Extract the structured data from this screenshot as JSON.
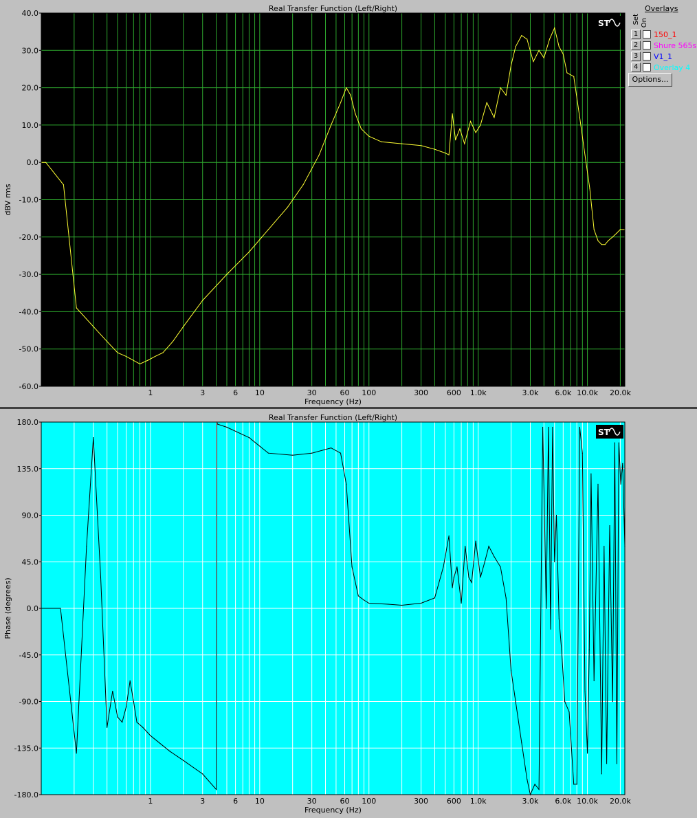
{
  "overlays": {
    "title": "Overlays",
    "header_set": "Set",
    "header_on": "On",
    "items": [
      {
        "num": "1",
        "label": "150_1",
        "color": "#ff0000"
      },
      {
        "num": "2",
        "label": "Shure 565s",
        "color": "#ff00ff"
      },
      {
        "num": "3",
        "label": "V1_1",
        "color": "#0000ff"
      },
      {
        "num": "4",
        "label": "Overlay 4",
        "color": "#00ffff"
      }
    ],
    "options_label": "Options..."
  },
  "logo_text": "ST",
  "chart_data": [
    {
      "type": "line",
      "title": "Real Transfer Function (Left/Right)",
      "xlabel": "Frequency (Hz)",
      "ylabel": "dBV rms",
      "xscale": "log",
      "xlim": [
        0.1,
        22000
      ],
      "ylim": [
        -60,
        40
      ],
      "grid": true,
      "background": "#000000",
      "grid_color": "#2ea82e",
      "line_color": "#ffff33",
      "x_ticks": [
        1,
        3,
        6,
        10,
        30,
        60,
        100,
        300,
        600,
        1000,
        3000,
        6000,
        10000,
        20000
      ],
      "x_tick_labels": [
        "1",
        "3",
        "6",
        "10",
        "30",
        "60",
        "100",
        "300",
        "600",
        "1.0k",
        "3.0k",
        "6.0k",
        "10.0k",
        "20.0k"
      ],
      "y_ticks": [
        40,
        30,
        20,
        10,
        0,
        -10,
        -20,
        -30,
        -40,
        -50,
        -60
      ],
      "y_tick_labels": [
        "40.0",
        "30.0",
        "20.0",
        "10.0",
        "0.0",
        "-10.0",
        "-20.0",
        "-30.0",
        "-40.0",
        "-50.0",
        "-60.0"
      ],
      "series": [
        {
          "x": [
            0.1,
            0.11,
            0.16,
            0.21,
            0.3,
            0.4,
            0.5,
            0.6,
            0.8,
            0.95,
            1.1,
            1.3,
            1.6,
            2,
            3,
            5,
            8,
            12,
            18,
            25,
            35,
            45,
            55,
            62,
            68,
            75,
            85,
            100,
            130,
            200,
            300,
            400,
            500,
            540,
            580,
            620,
            680,
            750,
            850,
            950,
            1050,
            1200,
            1400,
            1600,
            1800,
            2000,
            2200,
            2500,
            2800,
            3200,
            3600,
            4000,
            4500,
            5000,
            5500,
            6000,
            6500,
            7500,
            8500,
            9500,
            10500,
            11500,
            12500,
            13500,
            14500,
            15500,
            17000,
            18500,
            20000,
            22000
          ],
          "y": [
            0,
            0,
            -6,
            -39,
            -44,
            -48,
            -51,
            -52,
            -54,
            -53,
            -52,
            -51,
            -48,
            -44,
            -37,
            -30,
            -24,
            -18,
            -12,
            -6,
            2,
            10,
            16,
            20,
            18,
            13,
            9,
            7,
            5.5,
            5,
            4.5,
            3.5,
            2.5,
            2,
            13,
            6,
            9,
            5,
            11,
            8,
            10,
            16,
            12,
            20,
            18,
            26,
            31,
            34,
            33,
            27,
            30,
            28,
            33,
            36,
            31,
            29,
            24,
            23,
            12,
            2,
            -7,
            -18,
            -21,
            -22,
            -22,
            -21,
            -20,
            -19,
            -18,
            -18
          ]
        }
      ]
    },
    {
      "type": "line",
      "title": "Real Transfer Function (Left/Right)",
      "xlabel": "Frequency (Hz)",
      "ylabel": "Phase (degrees)",
      "xscale": "log",
      "xlim": [
        0.1,
        22000
      ],
      "ylim": [
        -180,
        180
      ],
      "grid": true,
      "background": "#00ffff",
      "grid_color": "#ffffff",
      "line_color": "#000000",
      "x_ticks": [
        1,
        3,
        6,
        10,
        30,
        60,
        100,
        300,
        600,
        1000,
        3000,
        6000,
        10000,
        20000
      ],
      "x_tick_labels": [
        "1",
        "3",
        "6",
        "10",
        "30",
        "60",
        "100",
        "300",
        "600",
        "1.0k",
        "3.0k",
        "6.0k",
        "10.0k",
        "20.0k"
      ],
      "y_ticks": [
        180,
        135,
        90,
        45,
        0,
        -45,
        -90,
        -135,
        -180
      ],
      "y_tick_labels": [
        "180.0",
        "135.0",
        "90.0",
        "45.0",
        "0.0",
        "-45.0",
        "-90.0",
        "-135.0",
        "-180.0"
      ],
      "series": [
        {
          "x": [
            0.1,
            0.15,
            0.21,
            0.26,
            0.3,
            0.35,
            0.4,
            0.45,
            0.5,
            0.55,
            0.6,
            0.65,
            0.7,
            0.75,
            0.85,
            1,
            1.5,
            2,
            3,
            4,
            4.05,
            4.1,
            5,
            8,
            12,
            20,
            30,
            45,
            55,
            62,
            70,
            80,
            90,
            100,
            150,
            200,
            300,
            400,
            480,
            540,
            580,
            600,
            640,
            700,
            760,
            820,
            870,
            950,
            1050,
            1150,
            1250,
            1400,
            1600,
            1800,
            2000,
            2200,
            2500,
            2800,
            3000,
            3300,
            3600,
            3900,
            4200,
            4400,
            4600,
            4800,
            5000,
            5200,
            5500,
            5800,
            6200,
            6800,
            7500,
            8000,
            8500,
            9000,
            9500,
            10000,
            10400,
            10800,
            11500,
            12500,
            13500,
            14200,
            15000,
            16000,
            17000,
            17800,
            18600,
            19400,
            20200,
            21000,
            22000
          ],
          "y": [
            0,
            0,
            -140,
            60,
            165,
            30,
            -115,
            -80,
            -105,
            -110,
            -95,
            -70,
            -90,
            -110,
            -115,
            -123,
            -138,
            -147,
            -160,
            -175,
            180,
            178,
            175,
            165,
            150,
            148,
            150,
            155,
            150,
            120,
            40,
            12,
            8,
            5,
            4,
            3,
            5,
            10,
            40,
            70,
            20,
            30,
            40,
            5,
            60,
            30,
            25,
            65,
            30,
            45,
            60,
            50,
            40,
            10,
            -60,
            -90,
            -130,
            -165,
            -180,
            -170,
            -175,
            175,
            0,
            175,
            -20,
            175,
            45,
            90,
            -10,
            -40,
            -90,
            -100,
            -170,
            -170,
            175,
            150,
            -80,
            -140,
            -40,
            130,
            -70,
            120,
            -160,
            60,
            -150,
            80,
            -90,
            160,
            -150,
            160,
            120,
            140,
            60
          ]
        }
      ]
    }
  ]
}
